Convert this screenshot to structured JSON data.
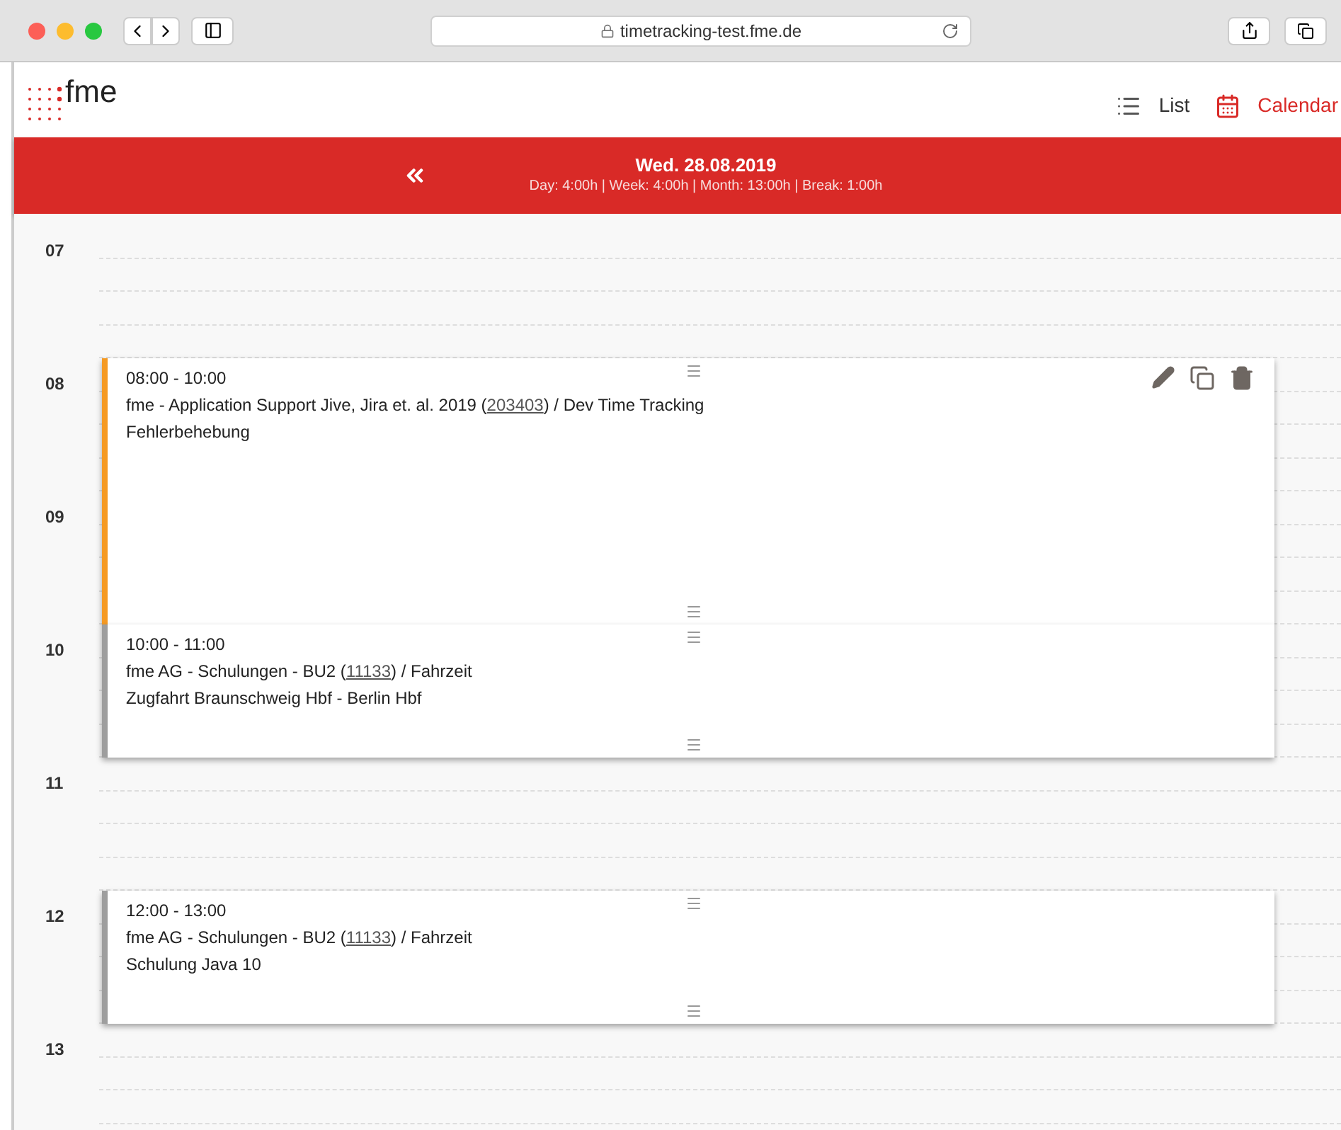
{
  "browser": {
    "url": "timetracking-test.fme.de"
  },
  "header": {
    "logo": "fme",
    "nav": [
      {
        "label": "List",
        "kind": "list",
        "selected": false
      },
      {
        "label": "Calendar",
        "kind": "calendar",
        "selected": true
      }
    ]
  },
  "day_bar": {
    "title": "Wed. 28.08.2019",
    "summary": "Day: 4:00h | Week: 4:00h | Month: 13:00h | Break: 1:00h"
  },
  "hours": [
    {
      "label": "07"
    },
    {
      "label": "08"
    },
    {
      "label": "09"
    },
    {
      "label": "10"
    },
    {
      "label": "11"
    },
    {
      "label": "12"
    },
    {
      "label": "13"
    }
  ],
  "entries": [
    {
      "time": "08:00 - 10:00",
      "project": "fme - Application Support Jive, Jira et. al. 2019 (",
      "code": "203403",
      "task": ") / Dev Time Tracking",
      "note": "Fehlerbehebung",
      "color": "#f59a23",
      "actions_shown": true
    },
    {
      "time": "10:00 - 11:00",
      "project": "fme AG - Schulungen - BU2 (",
      "code": "11133",
      "task": ") / Fahrzeit",
      "note": "Zugfahrt Braunschweig Hbf - Berlin Hbf",
      "color": "#9e9e9e",
      "actions_shown": false
    },
    {
      "time": "12:00 - 13:00",
      "project": "fme AG - Schulungen - BU2 (",
      "code": "11133",
      "task": ") / Fahrzeit",
      "note": "Schulung Java 10",
      "color": "#9e9e9e",
      "actions_shown": false
    }
  ]
}
